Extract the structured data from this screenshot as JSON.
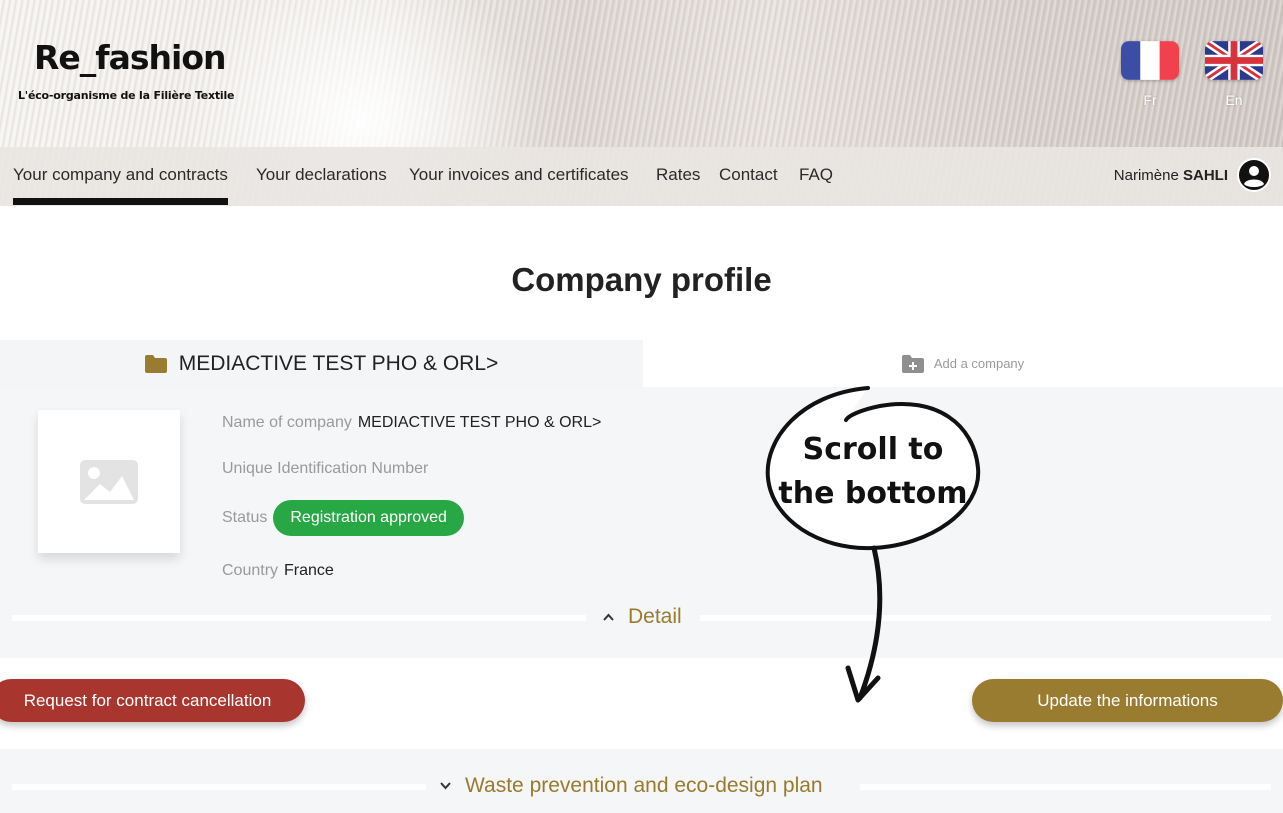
{
  "header": {
    "logo_text": "Re_fashion",
    "logo_tagline": "L'éco-organisme de la Filière Textile",
    "languages": [
      {
        "code": "fr",
        "label": "Fr",
        "icon": "french-flag-icon"
      },
      {
        "code": "en",
        "label": "En",
        "icon": "uk-flag-icon"
      }
    ]
  },
  "nav": {
    "items": [
      {
        "label": "Your company and contracts",
        "active": true
      },
      {
        "label": "Your declarations",
        "active": false
      },
      {
        "label": "Your invoices and certificates",
        "active": false
      },
      {
        "label": "Rates",
        "active": false
      },
      {
        "label": "Contact",
        "active": false
      },
      {
        "label": "FAQ",
        "active": false
      }
    ],
    "user": {
      "first_name": "Narimène",
      "last_name": "SAHLI",
      "icon": "account-circle-icon"
    }
  },
  "main": {
    "page_title": "Company profile",
    "company_tab": {
      "label": "MEDIACTIVE TEST PHO & ORL>",
      "icon": "folder-icon"
    },
    "add_company": {
      "label": "Add a company",
      "icon": "folder-plus-icon"
    },
    "logo_placeholder_icon": "image-icon",
    "fields": {
      "name_label": "Name of company",
      "name_value": "MEDIACTIVE TEST PHO & ORL>",
      "uin_label": "Unique Identification Number",
      "uin_value": "",
      "status_label": "Status",
      "status_value": "Registration approved",
      "country_label": "Country",
      "country_value": "France"
    },
    "detail_toggle": {
      "label": "Detail",
      "icon": "chevron-up-icon"
    },
    "buttons": {
      "cancel_label": "Request for contract cancellation",
      "update_label": "Update the informations"
    },
    "waste_toggle": {
      "label": "Waste prevention and eco-design plan",
      "icon": "chevron-down-icon"
    }
  },
  "annotation": {
    "text_line1": "Scroll to",
    "text_line2": "the bottom",
    "icon": "arrow-down-icon"
  },
  "colors": {
    "accent_gold": "#9a7c30",
    "status_green": "#28a745",
    "danger_red": "#a8352e",
    "panel_bg": "#f5f6f8"
  }
}
